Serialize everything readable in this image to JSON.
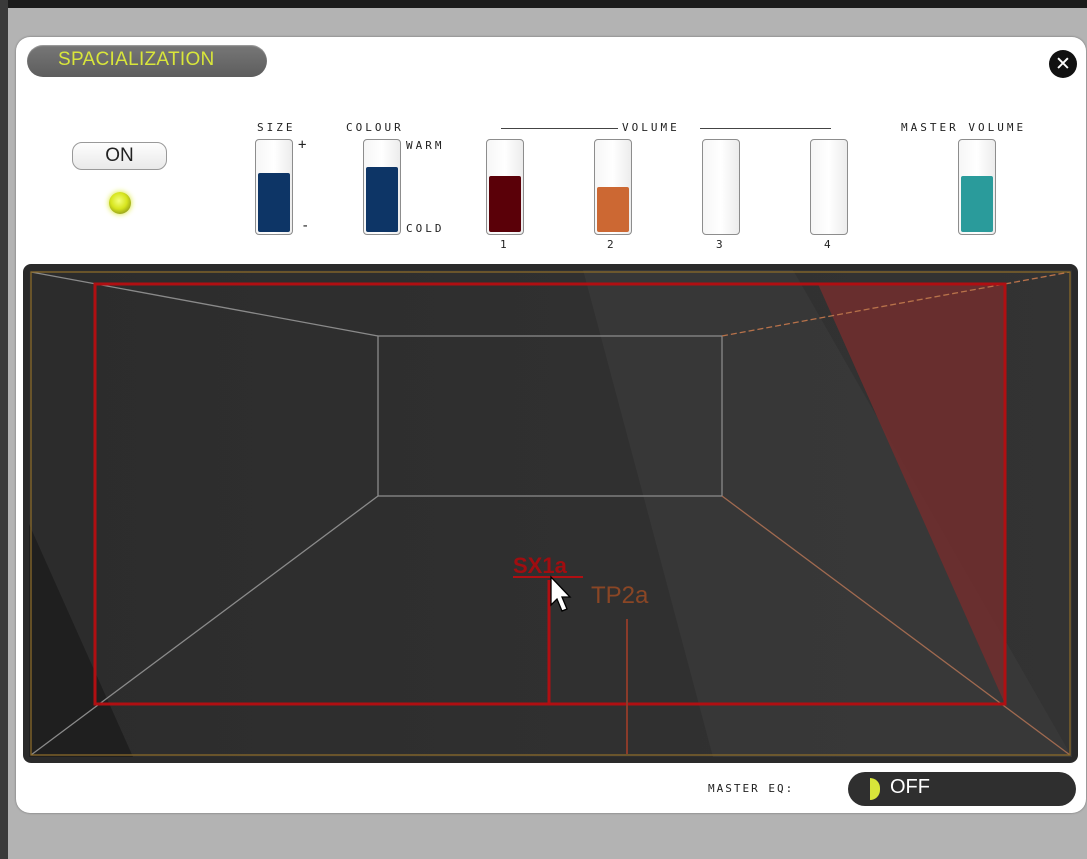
{
  "panel": {
    "title": "SPACIALIZATION",
    "close_icon": "close-icon"
  },
  "power": {
    "button_label": "ON",
    "led_color": "#d7e51e"
  },
  "size": {
    "label": "SIZE",
    "plus": "+",
    "minus": "-",
    "level": 0.65,
    "color": "#0d3566"
  },
  "colour": {
    "label": "COLOUR",
    "warm": "WARM",
    "cold": "COLD",
    "level": 0.72,
    "color": "#0d3566"
  },
  "volume": {
    "label": "VOLUME",
    "channels": [
      {
        "label": "1",
        "level": 0.62,
        "color": "#5a0008"
      },
      {
        "label": "2",
        "level": 0.5,
        "color": "#cc6833"
      },
      {
        "label": "3",
        "level": 0.0,
        "color": "#ffffff"
      },
      {
        "label": "4",
        "level": 0.0,
        "color": "#ffffff"
      }
    ]
  },
  "master_volume": {
    "label": "MASTER VOLUME",
    "level": 0.62,
    "color": "#2a9b9b"
  },
  "room": {
    "sources": [
      {
        "label": "SX1a",
        "color": "#a00d10"
      },
      {
        "label": "TP2a",
        "color": "#8a4625"
      }
    ]
  },
  "master_eq": {
    "label": "MASTER EQ:",
    "state": "OFF",
    "knob_color": "#d8e63a"
  }
}
